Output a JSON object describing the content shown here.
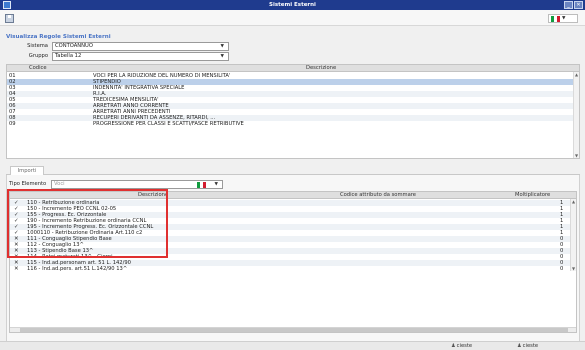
{
  "window": {
    "title": "Sistemi Esterni",
    "minimize": "_",
    "close": "✕"
  },
  "toolbar": {
    "language_flag": "italy-flag"
  },
  "rules_section": {
    "title": "Visualizza Regole Sistemi Esterni",
    "sistema_label": "Sistema",
    "sistema_value": "CONTOANNUO",
    "gruppo_label": "Gruppo",
    "gruppo_value": "Tabella 12"
  },
  "rules_grid": {
    "columns": [
      "Codice",
      "Descrizione"
    ],
    "rows": [
      {
        "code": "01",
        "desc": "VOCI PER LA RIDUZIONE DEL NUMERO DI MENSILITA'"
      },
      {
        "code": "02",
        "desc": "STIPENDIO"
      },
      {
        "code": "03",
        "desc": "INDENNITA' INTEGRATIVA SPECIALE"
      },
      {
        "code": "04",
        "desc": "R.I.A."
      },
      {
        "code": "05",
        "desc": "TREDICESIMA MENSILITA'"
      },
      {
        "code": "06",
        "desc": "ARRETRATI ANNO CORRENTE"
      },
      {
        "code": "07",
        "desc": "ARRETRATI ANNI PRECEDENTI"
      },
      {
        "code": "08",
        "desc": "RECUPERI DERIVANTI DA ASSENZE, RITARDI, ..."
      },
      {
        "code": "09",
        "desc": "PROGRESSIONE PER CLASSI E SCATTI/FASCE RETRIBUTIVE"
      }
    ]
  },
  "tabs": {
    "importi": "Importi"
  },
  "importi": {
    "tipo_label": "Tipo Elemento",
    "tipo_value": "Voci",
    "columns": [
      "Descrizione",
      "Codice attributo da sommare",
      "Moltiplicatore"
    ],
    "rows": [
      {
        "status": "check",
        "desc": "110 - Retribuzione ordinaria",
        "mult": "1"
      },
      {
        "status": "check",
        "desc": "150 - Incremento PEO CCNL 02-05",
        "mult": "1"
      },
      {
        "status": "check",
        "desc": "155 - Progress. Ec. Orizzontale",
        "mult": "1"
      },
      {
        "status": "check",
        "desc": "190 - Incremento Retribuzione ordinaria CCNL",
        "mult": "1"
      },
      {
        "status": "check",
        "desc": "195 - Incremento Progress. Ec. Orizzontale CCNL",
        "mult": "1"
      },
      {
        "status": "check",
        "desc": "1000110 - Retribuzione Ordinaria Art.110 c2",
        "mult": "1"
      },
      {
        "status": "x",
        "desc": "111 - Conguaglio Stipendio Base",
        "mult": "0"
      },
      {
        "status": "x",
        "desc": "112 - Conguaglio 13^",
        "mult": "0"
      },
      {
        "status": "x",
        "desc": "113 - Stipendio Base 13^",
        "mult": "0"
      },
      {
        "status": "x",
        "desc": "114 - Ratei maturati 13^ - Giorni",
        "mult": "0"
      },
      {
        "status": "x",
        "desc": "115 - Ind.ad.personam art. 51 L. 142/90",
        "mult": "0"
      },
      {
        "status": "x",
        "desc": "116 - Ind.ad.pers. art.51 L.142/90 13^",
        "mult": "0"
      }
    ]
  },
  "status_bar": {
    "left": "cieste",
    "right": "cieste"
  }
}
